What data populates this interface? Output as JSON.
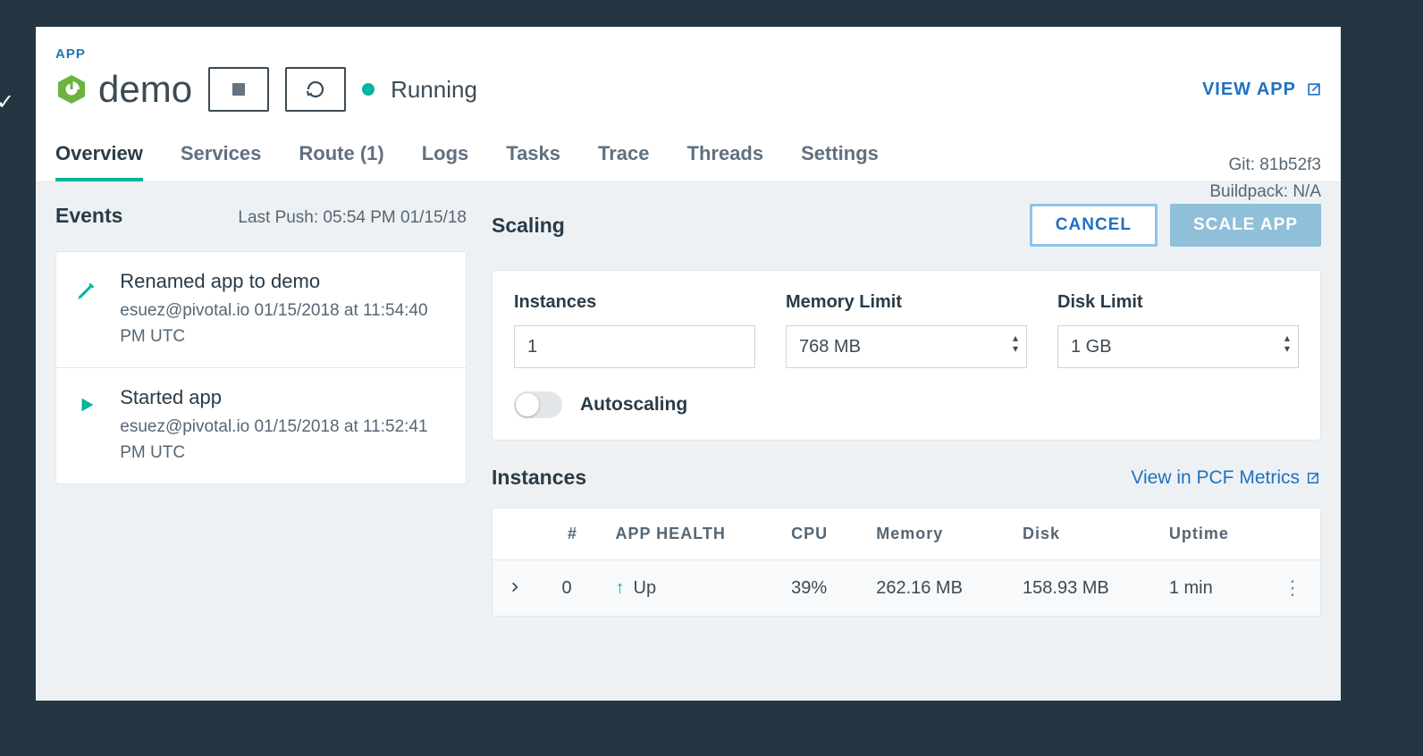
{
  "header": {
    "app_label": "APP",
    "app_name": "demo",
    "status": "Running",
    "view_app_label": "VIEW APP",
    "git_label": "Git: 81b52f3",
    "buildpack_label": "Buildpack: N/A"
  },
  "tabs": [
    {
      "label": "Overview",
      "active": true
    },
    {
      "label": "Services"
    },
    {
      "label": "Route (1)"
    },
    {
      "label": "Logs"
    },
    {
      "label": "Tasks"
    },
    {
      "label": "Trace"
    },
    {
      "label": "Threads"
    },
    {
      "label": "Settings"
    }
  ],
  "events": {
    "title": "Events",
    "last_push": "Last Push: 05:54 PM 01/15/18",
    "items": [
      {
        "icon": "pencil",
        "title": "Renamed app to demo",
        "meta": "esuez@pivotal.io 01/15/2018 at 11:54:40 PM UTC"
      },
      {
        "icon": "play",
        "title": "Started app",
        "meta": "esuez@pivotal.io 01/15/2018 at 11:52:41 PM UTC"
      }
    ]
  },
  "scaling": {
    "title": "Scaling",
    "cancel_label": "CANCEL",
    "scale_label": "SCALE APP",
    "instances_label": "Instances",
    "instances_value": "1",
    "memory_label": "Memory Limit",
    "memory_value": "768 MB",
    "disk_label": "Disk Limit",
    "disk_value": "1 GB",
    "autoscale_label": "Autoscaling"
  },
  "instances": {
    "title": "Instances",
    "pcf_link": "View in PCF Metrics",
    "columns": {
      "num": "#",
      "health": "APP HEALTH",
      "cpu": "CPU",
      "memory": "Memory",
      "disk": "Disk",
      "uptime": "Uptime"
    },
    "rows": [
      {
        "num": "0",
        "health": "Up",
        "cpu": "39%",
        "memory": "262.16 MB",
        "disk": "158.93 MB",
        "uptime": "1 min"
      }
    ]
  }
}
